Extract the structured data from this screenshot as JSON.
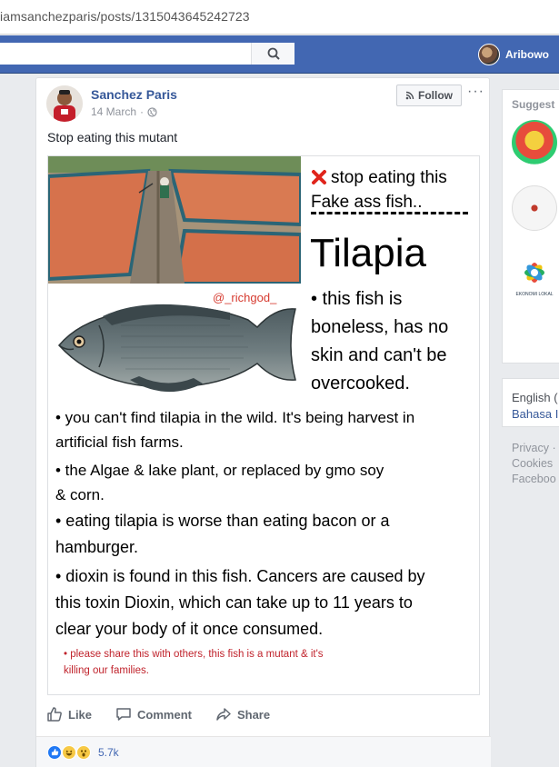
{
  "browser": {
    "url": "iamsanchezparis/posts/1315043645242723"
  },
  "topbar": {
    "user_name": "Aribowo",
    "search_placeholder": ""
  },
  "post": {
    "author": "Sanchez Paris",
    "date": "14 March",
    "date_sep": "·",
    "follow_label": "Follow",
    "more_label": "···",
    "text": "Stop eating this mutant",
    "image": {
      "headline_1": "stop eating this",
      "headline_2": "Fake ass fish..",
      "dashes": "----------",
      "title": "Tilapia",
      "handle": "@_richgod_",
      "right_lines": [
        "• this fish is",
        "boneless, has no",
        "skin and can't be",
        "overcooked."
      ],
      "bullet_1": [
        "• you can't find tilapia in the wild. It's being harvest in",
        "artificial fish farms."
      ],
      "bullet_2": [
        "• the Algae & lake plant, or replaced by gmo soy",
        "& corn."
      ],
      "bullet_3": [
        "• eating tilapia  is worse than eating bacon or a",
        "hamburger."
      ],
      "bullet_4": [
        "• dioxin is found in this fish. Cancers are caused by",
        "this toxin Dioxin, which can take up to 11 years to",
        "clear your body of it once consumed."
      ],
      "footnote": [
        "• please share this with others, this fish is a mutant & it's",
        "killing our families."
      ]
    },
    "actions": {
      "like": "Like",
      "comment": "Comment",
      "share": "Share"
    },
    "reactions": {
      "count": "5.7k",
      "types": [
        "like-icon",
        "haha-icon",
        "wow-icon"
      ]
    }
  },
  "sidebar": {
    "suggested_title": "Suggest",
    "suggestion_3_caption": "EKONOMI LOKAL",
    "language_current": "English (",
    "language_alt": "Bahasa I",
    "footer_links": [
      "Privacy ·",
      "Cookies",
      "Faceboo"
    ]
  },
  "colors": {
    "fb_blue": "#4267b2",
    "link_blue": "#365899",
    "alert_red": "#c0232c",
    "x_red": "#e0241b"
  }
}
